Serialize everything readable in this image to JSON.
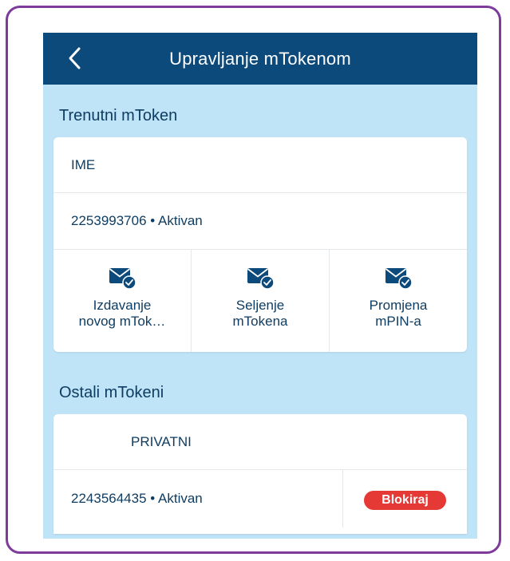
{
  "header": {
    "title": "Upravljanje mTokenom"
  },
  "current_section": {
    "title": "Trenutni mToken",
    "name": "IME",
    "token_info": "2253993706 • Aktivan",
    "actions": [
      {
        "line1": "Izdavanje",
        "line2": "novog mTok…",
        "icon": "envelope-check-icon"
      },
      {
        "line1": "Seljenje",
        "line2": "mTokena",
        "icon": "envelope-check-icon"
      },
      {
        "line1": "Promjena",
        "line2": "mPIN-a",
        "icon": "envelope-check-icon"
      }
    ]
  },
  "other_section": {
    "title": "Ostali mTokeni",
    "name": "PRIVATNI",
    "token_info": "2243564435 • Aktivan",
    "block_label": "Blokiraj"
  },
  "colors": {
    "header_bg": "#0d4a7c",
    "screen_bg": "#bfe3f7",
    "text": "#0f3d62",
    "block_badge": "#e53935",
    "frame": "#7e3b9a"
  }
}
